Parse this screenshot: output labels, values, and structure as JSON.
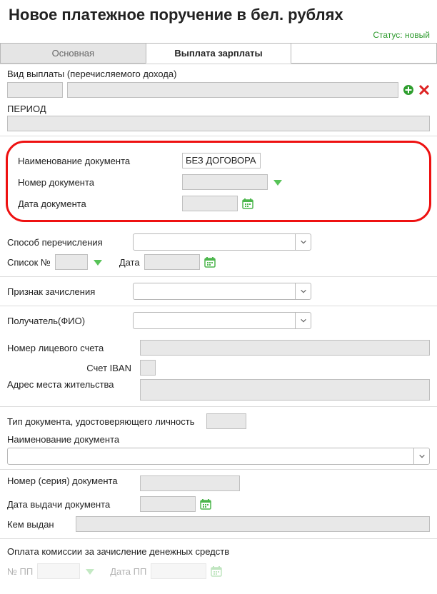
{
  "title": "Новое платежное поручение в бел. рублях",
  "status_label": "Статус:",
  "status_value": "новый",
  "tabs": {
    "t1": "Основная",
    "t2": "Выплата зарплаты",
    "t3": ""
  },
  "region1": {
    "payment_type_label": "Вид выплаты (перечисляемого дохода)",
    "period_label": "ПЕРИОД"
  },
  "highlight": {
    "doc_name_label": "Наименование документа",
    "doc_name_value": "БЕЗ ДОГОВОРА",
    "doc_number_label": "Номер документа",
    "doc_date_label": "Дата документа"
  },
  "region2": {
    "transfer_method_label": "Способ перечисления",
    "list_no_label": "Список №",
    "list_date_label": "Дата"
  },
  "region3": {
    "credit_sign_label": "Признак зачисления"
  },
  "region4": {
    "receiver_fio_label": "Получатель(ФИО)",
    "account_no_label": "Номер лицевого счета",
    "iban_label": "Счет IBAN",
    "address_label": "Адрес места жительства"
  },
  "region5": {
    "id_type_label": "Тип документа, удостоверяющего личность",
    "doc_name_label": "Наименование документа"
  },
  "region6": {
    "doc_series_label": "Номер (серия) документа",
    "issue_date_label": "Дата выдачи документа",
    "issued_by_label": "Кем выдан"
  },
  "region7": {
    "commission_label": "Оплата комиссии за зачисление денежных средств",
    "no_pp_label": "№ ПП",
    "date_pp_label": "Дата ПП"
  }
}
